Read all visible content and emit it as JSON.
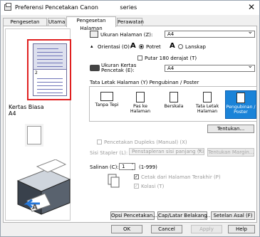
{
  "window": {
    "title": "Preferensi Pencetakan Canon            series"
  },
  "tabs": [
    {
      "label": "Pengesetan Cepat"
    },
    {
      "label": "Utama"
    },
    {
      "label": "Pengesetan Halaman"
    },
    {
      "label": "Perawatan"
    }
  ],
  "preview": {
    "page_number": "2",
    "media_type": "Kertas Biasa",
    "paper_size": "A4"
  },
  "page_size": {
    "label": "Ukuran Halaman (Z):",
    "value": "A4"
  },
  "orientation": {
    "label": "Orientasi (O):",
    "portrait": "Potret",
    "landscape": "Lanskap",
    "rotate": "Putar 180 derajat (T)"
  },
  "printer_paper": {
    "label": "Ukuran Kertas Pencetak (E):",
    "value": "A4"
  },
  "layout": {
    "group_label": "Tata Letak Halaman (Y) Pengubinan / Poster",
    "items": [
      {
        "label": "Tanpa Tepi"
      },
      {
        "label": "Pas ke Halaman"
      },
      {
        "label": "Berskala"
      },
      {
        "label": "Tata Letak Halaman"
      },
      {
        "label": "Pengubinan / Poster"
      }
    ],
    "specify": "Tentukan..."
  },
  "duplex": {
    "label": "Pencetakan Dupleks (Manual) (X)",
    "stapling_label": "Sisi Stapler (L):",
    "stapling_value": "Penstapleran sisi panjang (Kiri)",
    "margin_button": "Tentukan Margin..."
  },
  "copies": {
    "label": "Salinan (C):",
    "value": "1",
    "range": "(1-999)",
    "last_page": "Cetak dari Halaman Terakhir (P)",
    "collate": "Kolasi (T)"
  },
  "buttons": {
    "print_options": "Opsi Pencetakan...",
    "stamp": "Cap/Latar Belakang...",
    "defaults": "Setelan Asal (F)",
    "ok": "OK",
    "cancel": "Cancel",
    "apply": "Apply",
    "help": "Help"
  },
  "colors": {
    "selected": "#1a83d8",
    "highlight": "#e02020"
  }
}
